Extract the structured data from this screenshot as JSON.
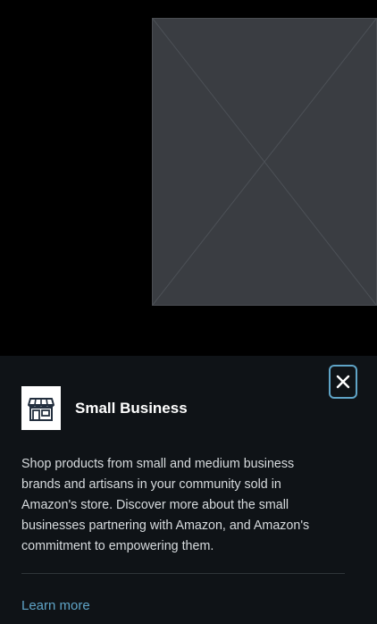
{
  "popover": {
    "title": "Small Business",
    "description": "Shop products from small and medium business brands and artisans in your community sold in Amazon's store. Discover more about the small businesses partnering with Amazon, and Amazon's commitment to empowering them.",
    "learn_more_label": "Learn more",
    "close_icon": "close-icon",
    "logo_icon": "storefront-icon"
  },
  "colors": {
    "background": "#000000",
    "panel": "#0f1317",
    "link": "#5fa4c7",
    "text": "#d7dbde"
  }
}
